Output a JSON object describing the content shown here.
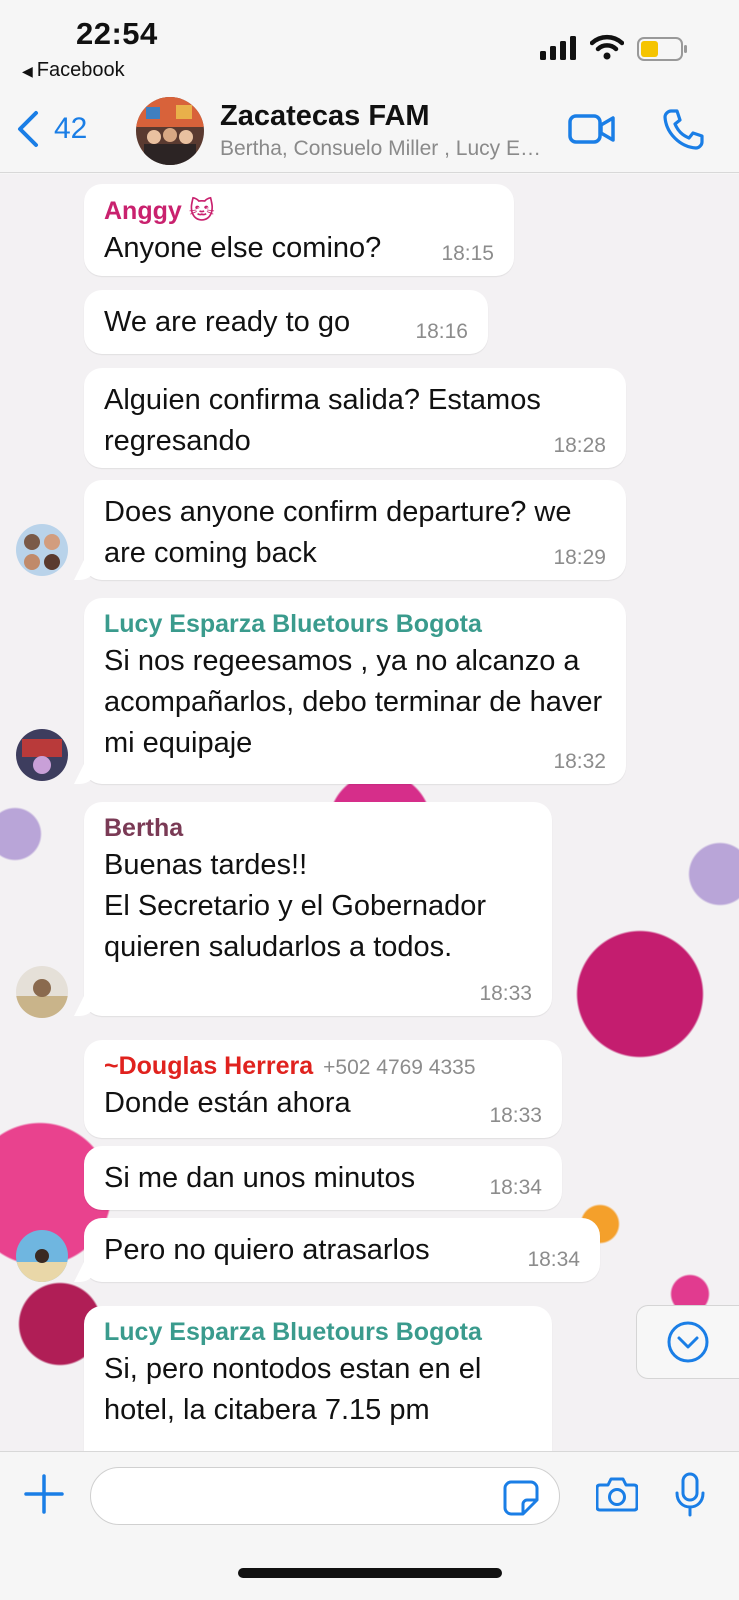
{
  "status_bar": {
    "time": "22:54",
    "back_app": "Facebook"
  },
  "header": {
    "back_count": "42",
    "title": "Zacatecas FAM",
    "subtitle": "Bertha, Consuelo Miller , Lucy Esparza Bluetours Bogota",
    "accent_color": "#1a7ee6"
  },
  "messages": [
    {
      "sender": "Anggy 🐱",
      "sender_color": "#c9216e",
      "text": "Anyone else comino?",
      "time": "18:15"
    },
    {
      "text": "We are ready  to go",
      "time": "18:16"
    },
    {
      "text": "Alguien confirma salida? Estamos regresando",
      "time": "18:28"
    },
    {
      "text": "Does anyone confirm departure? we are coming back",
      "time": "18:29"
    },
    {
      "sender": "Lucy Esparza  Bluetours Bogota",
      "sender_color": "#3a9b8d",
      "text": "Si nos regeesamos , ya no alcanzo a acompañarlos, debo terminar de haver mi equipaje",
      "time": "18:32"
    },
    {
      "sender": "Bertha",
      "sender_color": "#7a3a55",
      "text": "Buenas tardes!!\nEl Secretario y el Gobernador quieren saludarlos a todos.",
      "time": "18:33"
    },
    {
      "sender": "~Douglas Herrera",
      "sender_color": "#e0221e",
      "phone": "+502 4769 4335",
      "text": "Donde están ahora",
      "time": "18:33"
    },
    {
      "text": "Si me dan unos minutos",
      "time": "18:34"
    },
    {
      "text": "Pero no quiero atrasarlos",
      "time": "18:34"
    },
    {
      "sender": "Lucy Esparza  Bluetours Bogota",
      "sender_color": "#3a9b8d",
      "text": "Si, pero nontodos estan en el hotel, la citabera 7.15 pm",
      "time": ""
    }
  ]
}
